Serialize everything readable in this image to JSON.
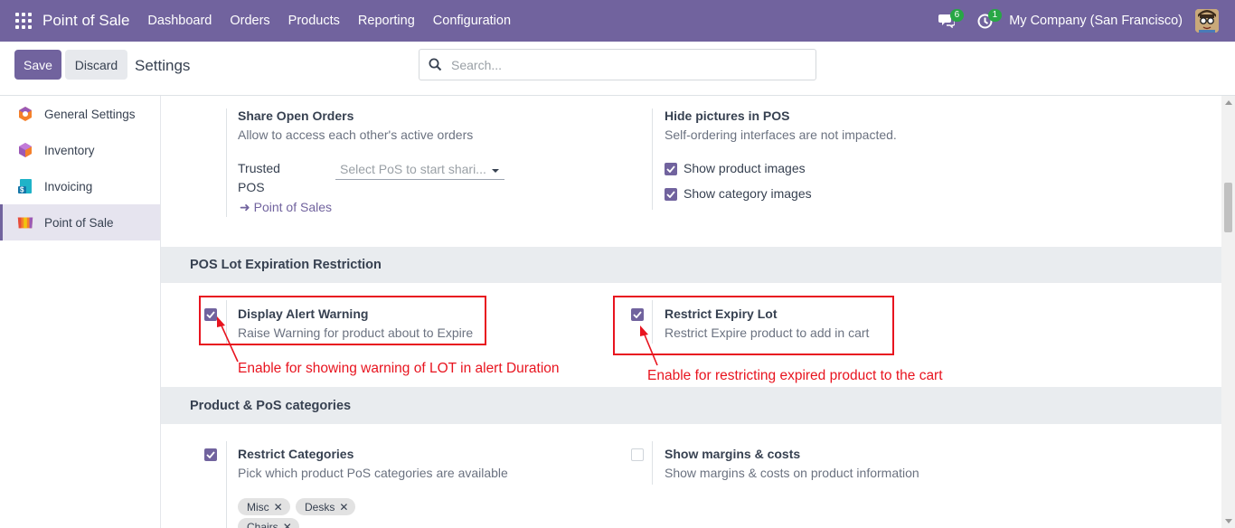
{
  "navbar": {
    "app_name": "Point of Sale",
    "menu": [
      "Dashboard",
      "Orders",
      "Products",
      "Reporting",
      "Configuration"
    ],
    "messages_badge": "6",
    "activity_badge": "1",
    "company": "My Company (San Francisco)"
  },
  "control": {
    "save_label": "Save",
    "discard_label": "Discard",
    "title": "Settings",
    "search_placeholder": "Search..."
  },
  "sidebar": {
    "items": [
      {
        "label": "General Settings",
        "icon": "general-settings-icon"
      },
      {
        "label": "Inventory",
        "icon": "inventory-icon"
      },
      {
        "label": "Invoicing",
        "icon": "invoicing-icon"
      },
      {
        "label": "Point of Sale",
        "icon": "point-of-sale-icon"
      }
    ]
  },
  "top_section": {
    "share": {
      "title": "Share Open Orders",
      "desc": "Allow to access each other's active orders",
      "trusted_label_1": "Trusted",
      "trusted_label_2": "POS",
      "select_placeholder": "Select PoS to start shari...",
      "link": "Point of Sales"
    },
    "hide_pictures": {
      "title": "Hide pictures in POS",
      "desc": "Self-ordering interfaces are not impacted.",
      "options": [
        "Show product images",
        "Show category images"
      ]
    }
  },
  "lot_section": {
    "header": "POS Lot Expiration Restriction",
    "display_alert": {
      "title": "Display Alert Warning",
      "desc": "Raise Warning for product about to Expire",
      "checked": true
    },
    "restrict_expiry": {
      "title": "Restrict Expiry Lot",
      "desc": "Restrict Expire product to add in cart",
      "checked": true
    },
    "annotation_left": "Enable for showing warning of LOT in alert Duration",
    "annotation_right": "Enable for restricting expired product to the cart"
  },
  "categories_section": {
    "header": "Product & PoS categories",
    "restrict_categories": {
      "title": "Restrict Categories",
      "desc": "Pick which product PoS categories are available",
      "checked": true,
      "tags": [
        "Misc",
        "Desks",
        "Chairs"
      ]
    },
    "margins": {
      "title": "Show margins & costs",
      "desc": "Show margins & costs on product information",
      "checked": false
    }
  },
  "colors": {
    "brand": "#71639e",
    "annotation": "#e8141f",
    "section_bg": "#e9ecef"
  }
}
